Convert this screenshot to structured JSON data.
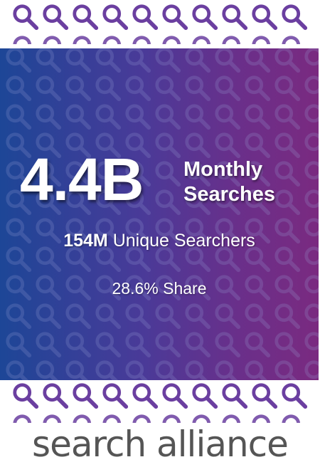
{
  "headline": {
    "value": "4.4B",
    "label_line1": "Monthly",
    "label_line2": "Searches"
  },
  "stats": {
    "searchers_value": "154M",
    "searchers_label": "Unique Searchers",
    "share": "28.6% Share"
  },
  "brand": {
    "name": "search alliance"
  },
  "decoration": {
    "icon": "magnifier-icon",
    "icons_per_row": 10,
    "gradient_colors": [
      "#1d4697",
      "#4a3a98",
      "#6a2f8a",
      "#7a2a80"
    ],
    "icon_color": "#6b3fa0",
    "text_color": "#ffffff",
    "brand_color": "#555555"
  }
}
